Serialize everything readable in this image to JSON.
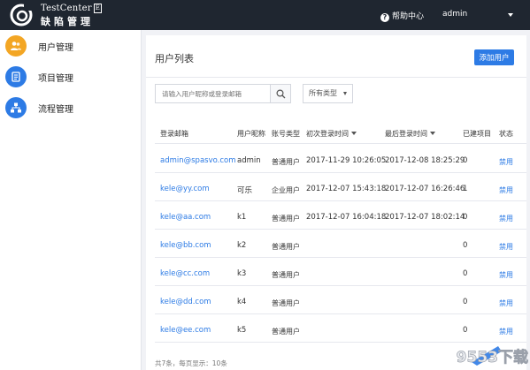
{
  "header": {
    "brand_en": "TestCenter",
    "brand_badge": "E",
    "brand_cn": "缺陷管理",
    "help_label": "帮助中心",
    "help_icon": "question-circle-icon",
    "username": "admin",
    "bg_color": "#1f2630"
  },
  "sidebar": {
    "items": [
      {
        "label": "用户管理",
        "icon": "users-icon",
        "color": "#f3a624"
      },
      {
        "label": "项目管理",
        "icon": "list-doc-icon",
        "color": "#2d7be5"
      },
      {
        "label": "流程管理",
        "icon": "workflow-icon",
        "color": "#2d7be5"
      }
    ]
  },
  "main": {
    "title": "用户列表",
    "add_button": "添加用户",
    "search_placeholder": "请输入用户昵称或登录邮箱",
    "type_filter": "所有类型",
    "columns": [
      "登录邮箱",
      "用户昵称",
      "账号类型",
      "初次登录时间",
      "最后登录时间",
      "已建项目",
      "状态"
    ],
    "rows": [
      {
        "email": "admin@spasvo.com",
        "nickname": "admin",
        "type": "普通用户",
        "first_login": "2017-11-29 10:26:05",
        "last_login": "2017-12-08 18:25:29",
        "projects": "0",
        "action": "禁用"
      },
      {
        "email": "kele@yy.com",
        "nickname": "可乐",
        "type": "企业用户",
        "first_login": "2017-12-07 15:43:18",
        "last_login": "2017-12-07 16:26:46",
        "projects": "1",
        "action": "禁用"
      },
      {
        "email": "kele@aa.com",
        "nickname": "k1",
        "type": "普通用户",
        "first_login": "2017-12-07 16:04:18",
        "last_login": "2017-12-07 18:02:14",
        "projects": "0",
        "action": "禁用"
      },
      {
        "email": "kele@bb.com",
        "nickname": "k2",
        "type": "普通用户",
        "first_login": "",
        "last_login": "",
        "projects": "0",
        "action": "禁用"
      },
      {
        "email": "kele@cc.com",
        "nickname": "k3",
        "type": "普通用户",
        "first_login": "",
        "last_login": "",
        "projects": "0",
        "action": "禁用"
      },
      {
        "email": "kele@dd.com",
        "nickname": "k4",
        "type": "普通用户",
        "first_login": "",
        "last_login": "",
        "projects": "0",
        "action": "禁用"
      },
      {
        "email": "kele@ee.com",
        "nickname": "k5",
        "type": "普通用户",
        "first_login": "",
        "last_login": "",
        "projects": "0",
        "action": "禁用"
      }
    ],
    "footer": "共7条，每页显示：10条",
    "accent": "#2d7be5"
  },
  "watermark": {
    "text": "9553下载",
    "icon": "watermark-logo-icon"
  }
}
